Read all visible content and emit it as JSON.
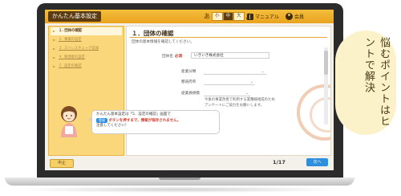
{
  "app": {
    "title": "かんたん基本設定",
    "font_size_prefix": "あ",
    "font_sizes": [
      "小",
      "中",
      "大"
    ],
    "font_size_selected": "中",
    "font_size_suffix": "あ",
    "manual_label": "マニュアル",
    "account_label": "会員"
  },
  "sidebar": {
    "items": [
      {
        "label": "１. 団体の確認"
      },
      {
        "label": "２. 事業の設定"
      },
      {
        "label": "３. ストレスチェック実施"
      },
      {
        "label": "４. 管理者の設定"
      },
      {
        "label": "５. 設定の確認"
      }
    ]
  },
  "main": {
    "section_title": "１．団体の確認",
    "description": "団体の基本情報を確認してください。",
    "org_name_label": "団体名",
    "required_mark": "必須",
    "org_name_value": "いきいき株式会社",
    "industry_label": "産業分類",
    "prefecture_label": "都道府県",
    "employees_label": "従業員規模",
    "note": "今後の事業改善で利用する業種様相成のため\nアンケートにご協力をお願いします。"
  },
  "bubble": {
    "line1": "かんたん基本設定は「5．設定の確認」画面で",
    "button_chip": "登録",
    "line2_emph": "ボタンを押すまで、情報が保存されません。",
    "line3": "注意してください！"
  },
  "footer": {
    "back_label": "中止",
    "page_counter": "1/17",
    "next_label": "次へ"
  },
  "hint": {
    "text": "悩むポイントはヒントで解決"
  },
  "colors": {
    "topbar": "#f3bd3a",
    "sidebar": "#f9d77a",
    "primary_button": "#2e8fde",
    "required": "#d23c2a"
  }
}
